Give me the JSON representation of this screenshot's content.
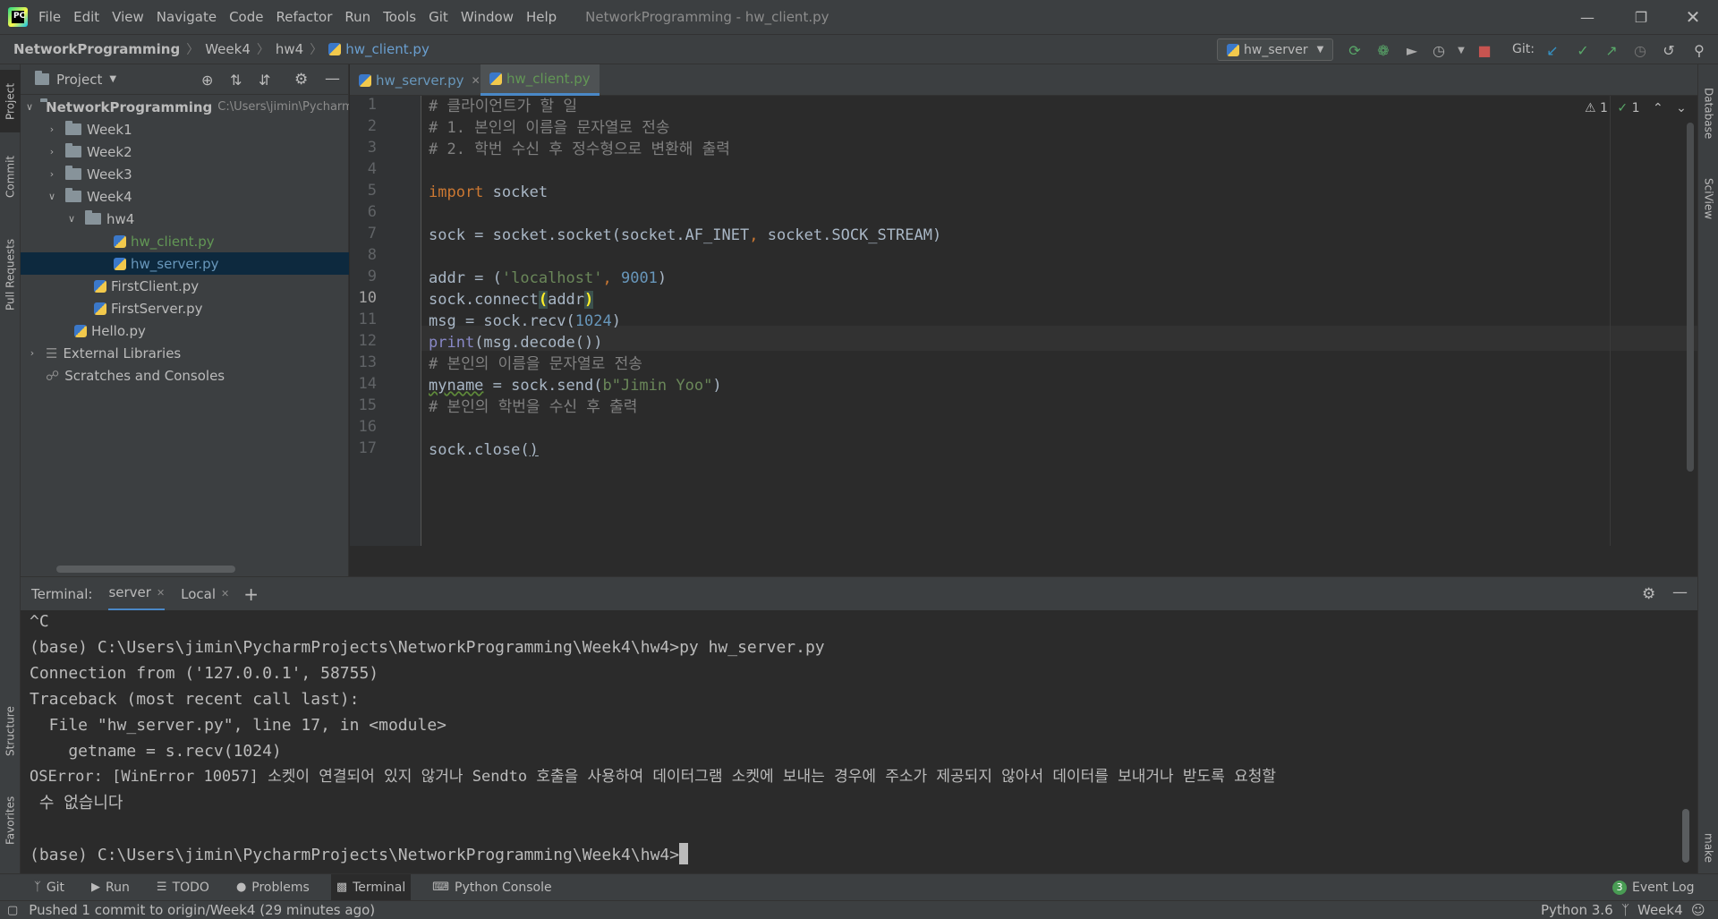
{
  "titlebar": {
    "menu": [
      "File",
      "Edit",
      "View",
      "Navigate",
      "Code",
      "Refactor",
      "Run",
      "Tools",
      "Git",
      "Window",
      "Help"
    ],
    "window_title": "NetworkProgramming - hw_client.py"
  },
  "breadcrumb": [
    "NetworkProgramming",
    "Week4",
    "hw4",
    "hw_client.py"
  ],
  "toolbar": {
    "run_config": "hw_server",
    "git_label": "Git:"
  },
  "left_stripe": [
    "Project",
    "Commit",
    "Pull Requests",
    "Structure",
    "Favorites"
  ],
  "right_stripe": [
    "Database",
    "SciView",
    "make"
  ],
  "project": {
    "title": "Project",
    "tree": [
      {
        "label": "NetworkProgramming",
        "extra": "C:\\Users\\jimin\\PycharmProjects\\NetworkProgramming"
      },
      {
        "label": "Week1"
      },
      {
        "label": "Week2"
      },
      {
        "label": "Week3"
      },
      {
        "label": "Week4"
      },
      {
        "label": "hw4"
      },
      {
        "label": "hw_client.py"
      },
      {
        "label": "hw_server.py"
      },
      {
        "label": "FirstClient.py"
      },
      {
        "label": "FirstServer.py"
      },
      {
        "label": "Hello.py"
      },
      {
        "label": "External Libraries"
      },
      {
        "label": "Scratches and Consoles"
      }
    ]
  },
  "editor": {
    "tabs": [
      "hw_server.py",
      "hw_client.py"
    ],
    "line_numbers": [
      "1",
      "2",
      "3",
      "4",
      "5",
      "6",
      "7",
      "8",
      "9",
      "10",
      "11",
      "12",
      "13",
      "14",
      "15",
      "16",
      "17"
    ],
    "current_line": "10",
    "inspection": {
      "warnings": "1",
      "weak": "1"
    },
    "lines": {
      "l1": "# 클라이언트가 할 일",
      "l2": "# 1. 본인의 이름을 문자열로 전송",
      "l3": "# 2. 학번 수신 후 정수형으로 변환해 출력",
      "l5_kw": "import",
      "l5_rest": " socket",
      "l7a": "sock = socket.socket(socket.AF_INET",
      "l7comma": ",",
      "l7b": " socket.SOCK_STREAM)",
      "l9a": "addr = (",
      "l9str": "'localhost'",
      "l9comma": ", ",
      "l9num": "9001",
      "l9b": ")",
      "l10a": "sock.connect",
      "l10open": "(",
      "l10mid": "addr",
      "l10close": ")",
      "l11a": "msg = sock.recv(",
      "l11num": "1024",
      "l11b": ")",
      "l12bi": "print",
      "l12rest": "(msg.decode())",
      "l13": "# 본인의 이름을 문자열로 전송",
      "l14a": "myname",
      "l14b": " = sock.send(",
      "l14str": "b\"Jimin Yoo\"",
      "l14c": ")",
      "l15": "# 본인의 학번을 수신 후 출력",
      "l17a": "sock.close(",
      "l17b": ")"
    }
  },
  "terminal": {
    "label": "Terminal:",
    "tabs": [
      "server",
      "Local"
    ],
    "lines": [
      "^C",
      "(base) C:\\Users\\jimin\\PycharmProjects\\NetworkProgramming\\Week4\\hw4>py hw_server.py",
      "Connection from ('127.0.0.1', 58755)",
      "Traceback (most recent call last):",
      "  File \"hw_server.py\", line 17, in <module>",
      "    getname = s.recv(1024)",
      "OSError: [WinError 10057] 소켓이 연결되어 있지 않거나 Sendto 호출을 사용하여 데이터그램 소켓에 보내는 경우에 주소가 제공되지 않아서 데이터를 보내거나 받도록 요청할",
      " 수 없습니다",
      "",
      "(base) C:\\Users\\jimin\\PycharmProjects\\NetworkProgramming\\Week4\\hw4>"
    ]
  },
  "bottom_tools": [
    "Git",
    "Run",
    "TODO",
    "Problems",
    "Terminal",
    "Python Console"
  ],
  "event_log": {
    "count": "3",
    "label": "Event Log"
  },
  "status": {
    "message": "Pushed 1 commit to origin/Week4 (29 minutes ago)",
    "interpreter": "Python 3.6",
    "branch": "Week4"
  },
  "colors": {
    "background": "#2b2b2b",
    "panel": "#3c3f41",
    "keyword": "#cc7832",
    "string": "#6a8759",
    "number": "#6897bb",
    "comment": "#808080",
    "accent": "#4a88c7"
  }
}
